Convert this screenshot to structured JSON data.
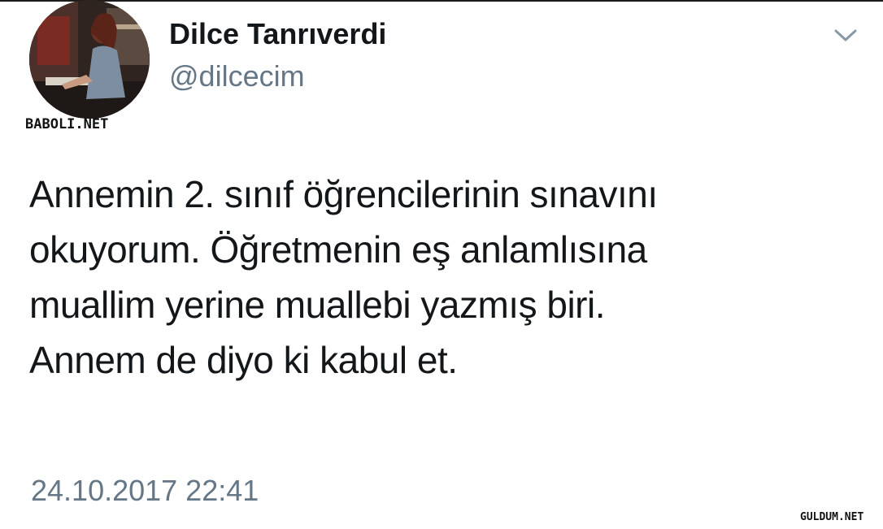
{
  "author": {
    "display_name": "Dilce Tanrıverdi",
    "handle": "@dilcecim",
    "avatar_icon": "profile-photo"
  },
  "menu": {
    "icon": "chevron-down-icon"
  },
  "tweet": {
    "lines": [
      "Annemin 2. sınıf öğrencilerinin sınavını",
      "okuyorum. Öğretmenin eş anlamlısına",
      "muallim yerine muallebi yazmış biri.",
      "Annem de diyo ki kabul et."
    ],
    "timestamp": "24.10.2017 22:41"
  },
  "watermarks": {
    "top_left": "BABOLI.NET",
    "bottom_right": "GULDUM.NET"
  },
  "colors": {
    "text_primary": "#14171a",
    "text_secondary": "#657786"
  }
}
